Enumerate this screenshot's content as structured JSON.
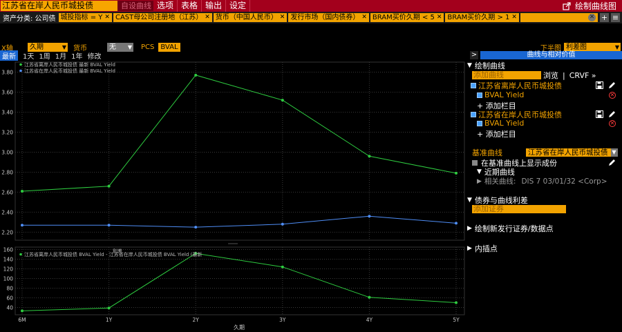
{
  "titlebar": {
    "title": "江苏省在岸人民币城投债",
    "tab": "自设曲线",
    "menu": [
      "选项",
      "表格",
      "输出",
      "设定"
    ],
    "right_title": "绘制曲线图"
  },
  "filters": {
    "prefix": "资产分类: 公司债",
    "chips": [
      "城投指标 = Y",
      "CAST母公司注册地（江苏）",
      "货币（中国人民币）",
      "发行市场（国内债券）",
      "BRAM买价久期 < 5",
      "BRAM买价久期 > 1"
    ]
  },
  "axis": {
    "x_label": "X轴",
    "x_value": "久期",
    "currency_label": "货币",
    "currency_value": "无",
    "pcs_label": "PCS",
    "pcs_value": "BVAL",
    "lower_label": "下半图",
    "lower_value": "利差图"
  },
  "periods": [
    "最新",
    "1天",
    "1周",
    "1月",
    "1年",
    "修改"
  ],
  "panel": {
    "header": "曲线与相对价值",
    "draw_curves": "绘制曲线",
    "add_curve_placeholder": "添加曲线",
    "browse": "浏览",
    "crvf": "CRVF »",
    "curve1": "江苏省离岸人民币城投债",
    "curve2": "江苏省在岸人民币城投债",
    "field": "BVAL Yield",
    "add_column": "+ 添加栏目",
    "base_curve_label": "基准曲线",
    "base_curve_value": "江苏省在岸人民币城投债",
    "show_components": "在基准曲线上显示成份",
    "recent_curve": "近期曲线",
    "related_curve_label": "相关曲线:",
    "related_curve_value": "DIS 7 03/01/32 <Corp>",
    "bond_spread": "债券与曲线利差",
    "add_security_placeholder": "添加证券",
    "new_issue": "绘制新发行证券/数据点",
    "interpolation": "内插点"
  },
  "chart_data": [
    {
      "type": "line",
      "categories": [
        "6M",
        "1Y",
        "2Y",
        "3Y",
        "4Y",
        "5Y"
      ],
      "x": [
        0.5,
        1,
        2,
        3,
        4,
        5
      ],
      "series": [
        {
          "name": "江苏省离岸人民币城投债 最新 BVAL Yield",
          "color": "#2ecc40",
          "values": [
            2.61,
            2.66,
            3.77,
            3.52,
            2.96,
            2.79
          ]
        },
        {
          "name": "江苏省在岸人民币城投债 最新 BVAL Yield",
          "color": "#4f8ef7",
          "values": [
            2.27,
            2.27,
            2.25,
            2.28,
            2.36,
            2.29
          ]
        }
      ],
      "ylim": [
        2.12,
        3.9
      ],
      "yticks": [
        "2.20",
        "2.40",
        "2.60",
        "2.80",
        "3.00",
        "3.20",
        "3.40",
        "3.60",
        "3.80"
      ],
      "grid": true,
      "legend": "top-left"
    },
    {
      "type": "line",
      "title": "利差",
      "categories": [
        "6M",
        "1Y",
        "2Y",
        "3Y",
        "4Y",
        "5Y"
      ],
      "x": [
        0.5,
        1,
        2,
        3,
        4,
        5
      ],
      "series": [
        {
          "name": "江苏省离岸人民币城投债 BVAL Yield - 江苏省在岸人民币城投债 BVAL Yield (最新",
          "color": "#2ecc40",
          "values": [
            33,
            39,
            152,
            124,
            61,
            50
          ]
        }
      ],
      "ylim": [
        25,
        165
      ],
      "yticks": [
        "40",
        "60",
        "80",
        "100",
        "120",
        "140",
        "160"
      ],
      "xlabel": "久期",
      "grid": true,
      "legend": "top-left"
    }
  ]
}
